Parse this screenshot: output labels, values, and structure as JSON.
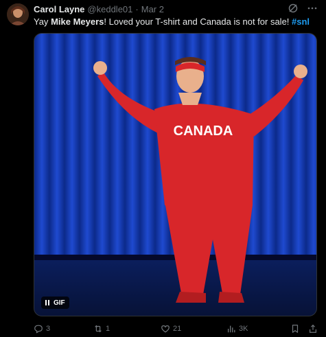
{
  "author": {
    "name": "Carol Layne",
    "handle": "@keddle01",
    "separator": "·",
    "date": "Mar 2"
  },
  "tweet": {
    "text_before": "Yay ",
    "mention_bold": "Mike Meyers",
    "text_after": "! Loved your T-shirt and Canada is not for sale! ",
    "hashtag": "#snl"
  },
  "media": {
    "badge_label": "GIF",
    "shirt_text": "CANADA"
  },
  "stats": {
    "replies": "3",
    "reposts": "1",
    "likes": "21",
    "views": "3K"
  },
  "icons": {
    "grok": "grok-icon",
    "more": "more-icon",
    "reply": "reply-icon",
    "repost": "repost-icon",
    "like": "heart-icon",
    "views": "views-icon",
    "bookmark": "bookmark-icon",
    "share": "share-icon",
    "pause": "pause-icon"
  },
  "colors": {
    "background": "#000000",
    "text": "#e7e9ea",
    "muted": "#71767b",
    "hashtag": "#1d9bf0",
    "curtain": "#1b3fb8",
    "tracksuit": "#d8262a"
  }
}
